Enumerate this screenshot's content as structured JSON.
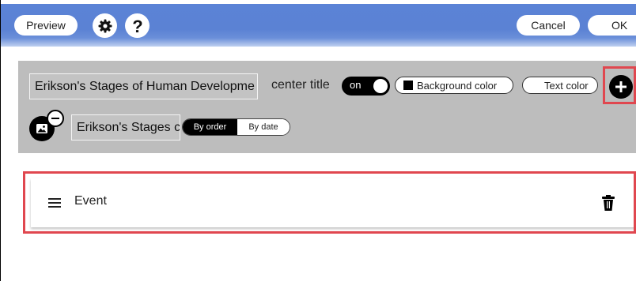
{
  "toolbar": {
    "preview_label": "Preview",
    "cancel_label": "Cancel",
    "ok_label": "OK"
  },
  "title_panel": {
    "title_value": "Erikson's Stages of Human Developme",
    "center_title_label": "center title",
    "center_title_toggle": "on",
    "background_color_label": "Background color",
    "background_swatch_color": "#000000",
    "text_color_label": "Text color",
    "text_swatch_color": "#ffffff",
    "subtitle_value": "Erikson's Stages c",
    "sort_options": [
      "By order",
      "By date"
    ],
    "sort_selected": "By order"
  },
  "events": [
    {
      "label": "Event"
    }
  ],
  "colors": {
    "toolbar_blue": "#5b83d6",
    "panel_gray": "#bdbdbd",
    "highlight_red": "#e0474f"
  }
}
